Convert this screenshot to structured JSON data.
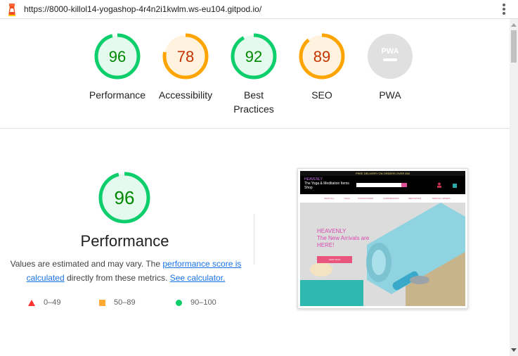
{
  "browser": {
    "url": "https://8000-killol14-yogashop-4r4n2i1kwlm.ws-eu104.gitpod.io/"
  },
  "gauges": [
    {
      "score": "96",
      "label": "Performance",
      "color": "#0cce6b",
      "fill": "#e5faef",
      "text_color": "#008800",
      "fraction": 0.96
    },
    {
      "score": "78",
      "label": "Accessibility",
      "color": "#ffa400",
      "fill": "#fff3e0",
      "text_color": "#c33300",
      "fraction": 0.78
    },
    {
      "score": "92",
      "label": "Best Practices",
      "color": "#0cce6b",
      "fill": "#e5faef",
      "text_color": "#008800",
      "fraction": 0.92
    },
    {
      "score": "89",
      "label": "SEO",
      "color": "#ffa400",
      "fill": "#fff3e0",
      "text_color": "#c33300",
      "fraction": 0.89
    },
    {
      "score": "PWA",
      "label": "PWA",
      "color": "#cccccc",
      "fill": "#e0e0e0",
      "text_color": "#ffffff",
      "fraction": 0
    }
  ],
  "performance": {
    "score": "96",
    "fraction": 0.96,
    "title": "Performance",
    "desc_part1": "Values are estimated and may vary. The ",
    "link1": "performance score is calculated",
    "desc_part2": " directly from these metrics. ",
    "link2": "See calculator."
  },
  "legend": {
    "fail": "0–49",
    "average": "50–89",
    "pass": "90–100"
  },
  "screenshot": {
    "banner": "FREE DELIVERY ON ORDERS OVER £50",
    "brand": "HEAVENLY",
    "tagline": "The Yoga & Meditation Items Shop",
    "nav": [
      "SHOP ALL",
      "YOGA",
      "CONDITIONING",
      "COMPRESSION",
      "MEDITATION",
      "SPECIAL OFFERS"
    ],
    "hero_brand": "HEAVENLY",
    "hero_line1": "The New Arrivals are",
    "hero_line2": "HERE!",
    "hero_button": "SHOP NOW"
  }
}
